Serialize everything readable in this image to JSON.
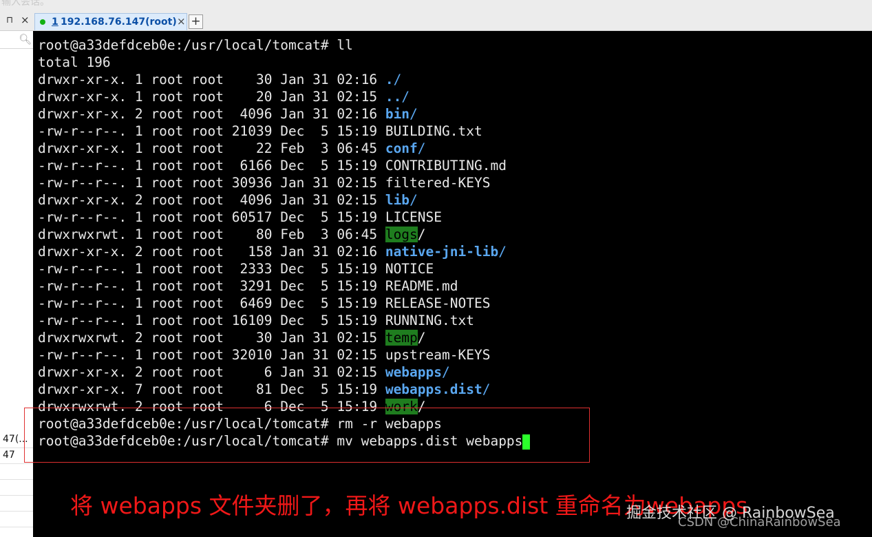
{
  "top_strip": {
    "text": "输入会话。"
  },
  "left_pane": {
    "pin_glyph": "⊓",
    "close_glyph": "×",
    "search_icon": "search-icon",
    "rows": [
      "47(...",
      "47",
      "",
      "",
      "",
      ""
    ]
  },
  "tab": {
    "number": "1",
    "title": "192.168.76.147(root)",
    "status_color": "#13b113",
    "close_glyph": "×"
  },
  "add_tab_label": "+",
  "terminal": {
    "prompt": "root@a33defdceb0e:/usr/local/tomcat#",
    "first_command": "ll",
    "total": "total 196",
    "listing": [
      {
        "meta": "drwxr-xr-x. 1 root root    30 Jan 31 02:16 ",
        "name": ".",
        "kind": "dir"
      },
      {
        "meta": "drwxr-xr-x. 1 root root    20 Jan 31 02:15 ",
        "name": "..",
        "kind": "dir"
      },
      {
        "meta": "drwxr-xr-x. 2 root root  4096 Jan 31 02:16 ",
        "name": "bin",
        "kind": "dir"
      },
      {
        "meta": "-rw-r--r--. 1 root root 21039 Dec  5 15:19 ",
        "name": "BUILDING.txt",
        "kind": "file"
      },
      {
        "meta": "drwxr-xr-x. 1 root root    22 Feb  3 06:45 ",
        "name": "conf",
        "kind": "dir"
      },
      {
        "meta": "-rw-r--r--. 1 root root  6166 Dec  5 15:19 ",
        "name": "CONTRIBUTING.md",
        "kind": "file"
      },
      {
        "meta": "-rw-r--r--. 1 root root 30936 Jan 31 02:15 ",
        "name": "filtered-KEYS",
        "kind": "file"
      },
      {
        "meta": "drwxr-xr-x. 2 root root  4096 Jan 31 02:15 ",
        "name": "lib",
        "kind": "dir"
      },
      {
        "meta": "-rw-r--r--. 1 root root 60517 Dec  5 15:19 ",
        "name": "LICENSE",
        "kind": "file"
      },
      {
        "meta": "drwxrwxrwt. 1 root root    80 Feb  3 06:45 ",
        "name": "logs",
        "kind": "sticky"
      },
      {
        "meta": "drwxr-xr-x. 2 root root   158 Jan 31 02:16 ",
        "name": "native-jni-lib",
        "kind": "dir"
      },
      {
        "meta": "-rw-r--r--. 1 root root  2333 Dec  5 15:19 ",
        "name": "NOTICE",
        "kind": "file"
      },
      {
        "meta": "-rw-r--r--. 1 root root  3291 Dec  5 15:19 ",
        "name": "README.md",
        "kind": "file"
      },
      {
        "meta": "-rw-r--r--. 1 root root  6469 Dec  5 15:19 ",
        "name": "RELEASE-NOTES",
        "kind": "file"
      },
      {
        "meta": "-rw-r--r--. 1 root root 16109 Dec  5 15:19 ",
        "name": "RUNNING.txt",
        "kind": "file"
      },
      {
        "meta": "drwxrwxrwt. 2 root root    30 Jan 31 02:15 ",
        "name": "temp",
        "kind": "sticky"
      },
      {
        "meta": "-rw-r--r--. 1 root root 32010 Jan 31 02:15 ",
        "name": "upstream-KEYS",
        "kind": "file"
      },
      {
        "meta": "drwxr-xr-x. 2 root root     6 Jan 31 02:15 ",
        "name": "webapps",
        "kind": "dir"
      },
      {
        "meta": "drwxr-xr-x. 7 root root    81 Dec  5 15:19 ",
        "name": "webapps.dist",
        "kind": "dir"
      },
      {
        "meta": "drwxrwxrwt. 2 root root     6 Dec  5 15:19 ",
        "name": "work",
        "kind": "sticky"
      }
    ],
    "commands": [
      "rm -r webapps",
      "mv webapps.dist webapps"
    ],
    "colors": {
      "background": "#000000",
      "text": "#e8e8e8",
      "directory": "#5aa7f0",
      "sticky_bg": "#1f7d1f",
      "cursor": "#2bff2b"
    }
  },
  "annotation": {
    "caption": "将 webapps 文件夹删了，再将 webapps.dist 重命名为webapps",
    "box_color": "#e03030",
    "caption_color": "#f01818"
  },
  "watermark": {
    "line1": "掘金技术社区 @ RainbowSea",
    "line2": "CSDN @ChinaRainbowSea"
  }
}
